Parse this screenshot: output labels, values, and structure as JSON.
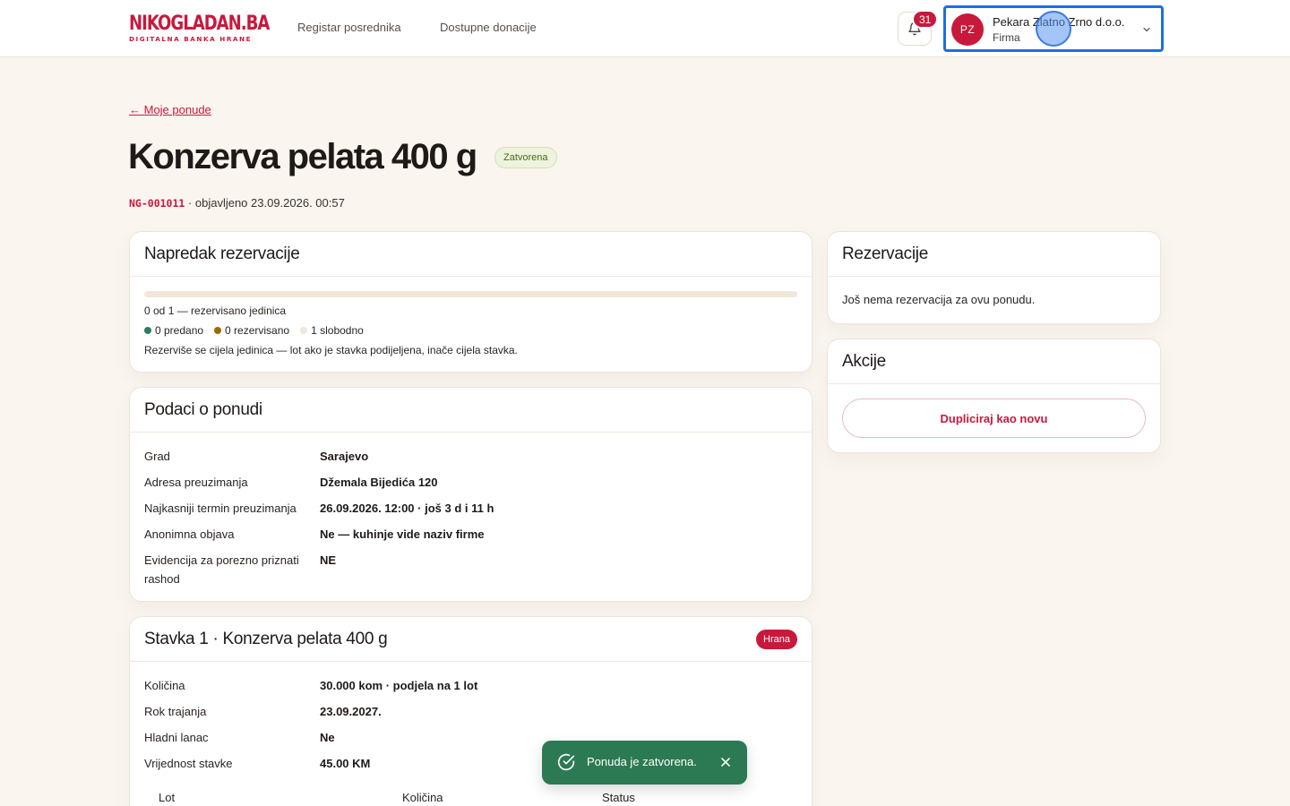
{
  "brand": {
    "logo_main_a": "NIKO",
    "logo_main_b": "GLADAN.BA",
    "logo_sub": "DIGITALNA BANKA HRANE",
    "accent": "#c8193c"
  },
  "nav": {
    "items": [
      {
        "label": "Registar posrednika"
      },
      {
        "label": "Dostupne donacije"
      }
    ]
  },
  "notifications": {
    "count": "31",
    "icon": "bell-icon"
  },
  "account": {
    "initials": "PZ",
    "name": "Pekara Zlatno Zrno d.o.o.",
    "role": "Firma"
  },
  "page": {
    "back_label": "← Moje ponude",
    "title": "Konzerva pelata 400 g",
    "status": "Zatvorena",
    "code": "NG-001011",
    "published": " · objavljeno 23.09.2026. 00:57"
  },
  "progress": {
    "title": "Napredak rezervacije",
    "reserved_fraction": 0,
    "summary": "0 od 1 — rezervisano jedinica",
    "legend": [
      {
        "label": "0 predano",
        "color": "#2e7d5b"
      },
      {
        "label": "0 rezervisano",
        "color": "#9a6b0a"
      },
      {
        "label": "1 slobodno",
        "color": "#f1e6d8"
      }
    ],
    "note": "Rezerviše se cijela jedinica — lot ako je stavka podijeljena, inače cijela stavka."
  },
  "offer": {
    "title": "Podaci o ponudi",
    "rows": [
      {
        "k": "Grad",
        "v": "Sarajevo"
      },
      {
        "k": "Adresa preuzimanja",
        "v": "Džemala Bijedića 120"
      },
      {
        "k": "Najkasniji termin preuzimanja",
        "v": "26.09.2026. 12:00 · još 3 d i 11 h"
      },
      {
        "k": "Anonimna objava",
        "v": "Ne — kuhinje vide naziv firme"
      },
      {
        "k": "Evidencija za porezno priznati rashod",
        "v": "NE"
      }
    ]
  },
  "item": {
    "title": "Stavka 1 · Konzerva pelata 400 g",
    "category": "Hrana",
    "rows": [
      {
        "k": "Količina",
        "v": "30.000 kom · podjela na 1 lot"
      },
      {
        "k": "Rok trajanja",
        "v": "23.09.2027."
      },
      {
        "k": "Hladni lanac",
        "v": "Ne"
      },
      {
        "k": "Vrijednost stavke",
        "v": "45.00 KM"
      }
    ],
    "lot_columns": [
      "Lot",
      "Količina",
      "Status"
    ]
  },
  "reservations": {
    "title": "Rezervacije",
    "empty": "Još nema rezervacija za ovu ponudu."
  },
  "actions": {
    "title": "Akcije",
    "duplicate_label": "Dupliciraj kao novu"
  },
  "toast": {
    "message": "Ponuda je zatvorena.",
    "color": "#2b7a53"
  }
}
